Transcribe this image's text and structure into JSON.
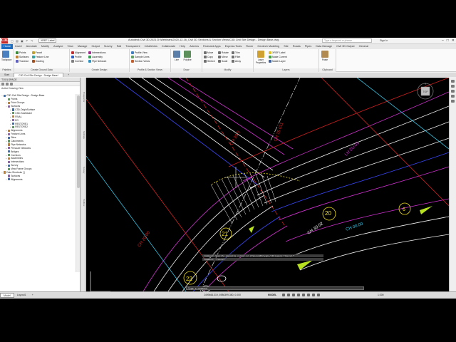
{
  "titlebar": {
    "logo": "C3D",
    "workspace": "XREF Label",
    "title": "Autodesk Civil 3D 2021   D:\\Webinars\\2020-12-16_Civil 3D Sections & Section Views\\C3D Civil Site Design - Design Base.dwg",
    "search_placeholder": "Type a keyword or phrase",
    "user": "Sign In",
    "win_min": "–",
    "win_max": "□",
    "win_close": "✕"
  },
  "ribbon_tabs": [
    "Home",
    "Insert",
    "Annotate",
    "Modify",
    "Analyze",
    "View",
    "Manage",
    "Output",
    "Survey",
    "Rail",
    "Transparent",
    "InfraWorks",
    "Collaborate",
    "Help",
    "Add-ins",
    "Featured Apps",
    "Express Tools",
    "Rover",
    "Geotech Modeling",
    "Site",
    "Roads",
    "Pipes",
    "Data Manage",
    "Civil 3D Output",
    "General"
  ],
  "ribbon": {
    "palettes_title": "Palettes",
    "palettes_btn": "Toolspace",
    "ground_data": {
      "title": "Create Ground Data",
      "items": [
        "Points",
        "Surfaces",
        "Traverse",
        "Parcel",
        "Feature Line",
        "Grading"
      ]
    },
    "create_design": {
      "title": "Create Design",
      "items": [
        "Alignment",
        "Profile",
        "Corridor",
        "Intersections",
        "Assembly",
        "Pipe Network"
      ]
    },
    "profile_section": {
      "title": "Profile & Section Views",
      "items": [
        "Profile View",
        "Sample Lines",
        "Section Views"
      ]
    },
    "draw": {
      "title": "Draw",
      "items": [
        "Line",
        "Polyline",
        "Circle"
      ]
    },
    "modify": {
      "title": "Modify",
      "items": [
        "Move",
        "Copy",
        "Stretch",
        "Rotate",
        "Mirror",
        "Scale",
        "Trim",
        "Fillet",
        "Array"
      ]
    },
    "layers": {
      "title": "Layers",
      "big": "Layer Properties",
      "items": [
        "XREF Label",
        "Make Current",
        "Match Layer"
      ]
    },
    "clipboard": {
      "title": "Clipboard",
      "big": "Paste"
    }
  },
  "doc_tabs": [
    "Start",
    "C3D Civil Site Design - Design Base*",
    "+"
  ],
  "toolspace": {
    "header": "TOOLSPACE",
    "view_label": "Active Drawing View",
    "tree": [
      {
        "level": 0,
        "label": "C3D Civil Site Design - Design Base",
        "toggle": "−"
      },
      {
        "level": 1,
        "label": "Points",
        "toggle": ""
      },
      {
        "level": 1,
        "label": "Point Groups",
        "toggle": "+"
      },
      {
        "level": 1,
        "label": "Surfaces",
        "toggle": "−"
      },
      {
        "level": 2,
        "label": "C3D-OriginSurface",
        "toggle": "+"
      },
      {
        "level": 2,
        "label": "C3D-TotalModel",
        "toggle": "+"
      },
      {
        "level": 2,
        "label": "FINAL",
        "toggle": "+"
      },
      {
        "level": 2,
        "label": "EG",
        "toggle": "+"
      },
      {
        "level": 2,
        "label": "RESTORE1",
        "toggle": "+"
      },
      {
        "level": 2,
        "label": "RESTORE2",
        "toggle": "+"
      },
      {
        "level": 1,
        "label": "Alignments",
        "toggle": "+"
      },
      {
        "level": 1,
        "label": "Feature Lines",
        "toggle": "+"
      },
      {
        "level": 1,
        "label": "Sites",
        "toggle": "+"
      },
      {
        "level": 1,
        "label": "Catchments",
        "toggle": "+"
      },
      {
        "level": 1,
        "label": "Pipe Networks",
        "toggle": "+"
      },
      {
        "level": 1,
        "label": "Pressure Networks",
        "toggle": "+"
      },
      {
        "level": 1,
        "label": "Bridges",
        "toggle": ""
      },
      {
        "level": 1,
        "label": "Corridors",
        "toggle": "+"
      },
      {
        "level": 1,
        "label": "Assemblies",
        "toggle": "+"
      },
      {
        "level": 1,
        "label": "Intersections",
        "toggle": ""
      },
      {
        "level": 1,
        "label": "Survey",
        "toggle": "+"
      },
      {
        "level": 1,
        "label": "View Frame Groups",
        "toggle": ""
      },
      {
        "level": 0,
        "label": "Data Shortcuts [ ]",
        "toggle": "−"
      },
      {
        "level": 1,
        "label": "Surfaces",
        "toggle": ""
      },
      {
        "level": 1,
        "label": "Alignments",
        "toggle": "+"
      }
    ],
    "side_tabs": [
      "Prospector",
      "Settings",
      "Survey",
      "Toolbox"
    ]
  },
  "drawing": {
    "labels": [
      "CH 20.0",
      "CH 15.011",
      "LH ZU.01",
      "20",
      "6",
      "21",
      "22",
      "CH 30.02",
      "CH 20.00",
      "CH 00.00"
    ],
    "viewcube_top": "TOP",
    "viewcube_n": "N"
  },
  "command": {
    "history": [
      "Command: Specify opposite corner or [Fence/WPolygon/CPolygon]:*Cancel*",
      "Command: *Cancel*"
    ],
    "prompt": "Type a command"
  },
  "status": {
    "model_tab": "Model",
    "layout_tab": "Layout1",
    "add_tab": "+",
    "coords": "2499466.319, 6986399.380, 0.000",
    "model_label": "MODEL",
    "scale": "1:200"
  },
  "colors": {
    "accent": "#1e6dc0",
    "alignment_red": "#d02020",
    "corridor_white": "#f2f2f2",
    "magenta": "#d030d0",
    "blue": "#3a48ff",
    "cyan": "#30c0e0",
    "yellow": "#f0e020",
    "green_arrow": "#b6e020"
  }
}
